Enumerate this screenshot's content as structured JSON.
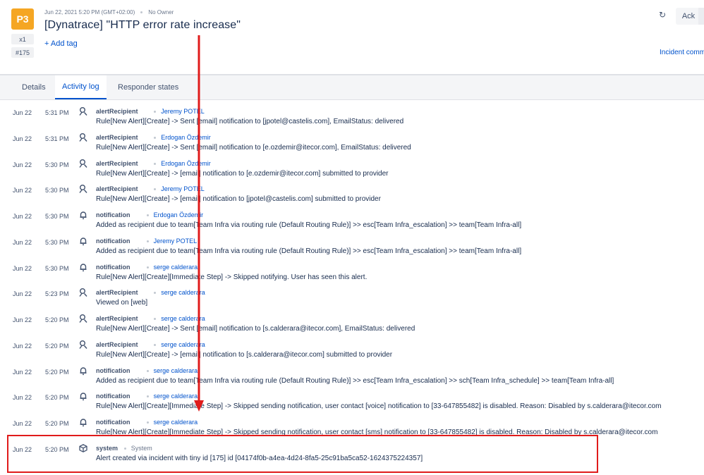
{
  "alert": {
    "priority": "P3",
    "count": "x1",
    "tiny_id": "#175",
    "created": "Jun 22, 2021 5:20 PM (GMT+02:00)",
    "owner": "No Owner",
    "title": "[Dynatrace] \"HTTP error rate increase\"",
    "add_tag": "+ Add tag",
    "incident_link": "Incident commander"
  },
  "actions": {
    "ack_label": "Ack"
  },
  "colors": {
    "priority": "#f5a623",
    "link": "#0052cc",
    "annotation": "#e01b1b"
  },
  "tabs": [
    {
      "label": "Details",
      "active": false
    },
    {
      "label": "Activity log",
      "active": true
    },
    {
      "label": "Responder states",
      "active": false
    }
  ],
  "activity": [
    {
      "date": "Jun 22",
      "time": "5:31 PM",
      "icon": "user-bell-icon",
      "type": "alertRecipient",
      "actor": "Jeremy POTEL",
      "message": "Rule[New Alert][Create] -> Sent [email] notification to [jpotel@castelis.com], EmailStatus: delivered"
    },
    {
      "date": "Jun 22",
      "time": "5:31 PM",
      "icon": "user-bell-icon",
      "type": "alertRecipient",
      "actor": "Erdogan Özdemir",
      "message": "Rule[New Alert][Create] -> Sent [email] notification to [e.ozdemir@itecor.com], EmailStatus: delivered"
    },
    {
      "date": "Jun 22",
      "time": "5:30 PM",
      "icon": "user-bell-icon",
      "type": "alertRecipient",
      "actor": "Erdogan Özdemir",
      "message": "Rule[New Alert][Create] -> [email] notification to [e.ozdemir@itecor.com] submitted to provider"
    },
    {
      "date": "Jun 22",
      "time": "5:30 PM",
      "icon": "user-bell-icon",
      "type": "alertRecipient",
      "actor": "Jeremy POTEL",
      "message": "Rule[New Alert][Create] -> [email] notification to [jpotel@castelis.com] submitted to provider"
    },
    {
      "date": "Jun 22",
      "time": "5:30 PM",
      "icon": "bell-icon",
      "type": "notification",
      "actor": "Erdogan Özdemir",
      "message": "Added as recipient due to team[Team Infra via routing rule (Default Routing Rule)] >> esc[Team Infra_escalation] >> team[Team Infra-all]"
    },
    {
      "date": "Jun 22",
      "time": "5:30 PM",
      "icon": "bell-icon",
      "type": "notification",
      "actor": "Jeremy POTEL",
      "message": "Added as recipient due to team[Team Infra via routing rule (Default Routing Rule)] >> esc[Team Infra_escalation] >> team[Team Infra-all]"
    },
    {
      "date": "Jun 22",
      "time": "5:30 PM",
      "icon": "bell-icon",
      "type": "notification",
      "actor": "serge calderara",
      "message": "Rule[New Alert][Create][Immediate Step] -> Skipped notifying. User has seen this alert."
    },
    {
      "date": "Jun 22",
      "time": "5:23 PM",
      "icon": "user-bell-icon",
      "type": "alertRecipient",
      "actor": "serge calderara",
      "message": "Viewed on [web]"
    },
    {
      "date": "Jun 22",
      "time": "5:20 PM",
      "icon": "user-bell-icon",
      "type": "alertRecipient",
      "actor": "serge calderara",
      "message": "Rule[New Alert][Create] -> Sent [email] notification to [s.calderara@itecor.com], EmailStatus: delivered"
    },
    {
      "date": "Jun 22",
      "time": "5:20 PM",
      "icon": "user-bell-icon",
      "type": "alertRecipient",
      "actor": "serge calderara",
      "message": "Rule[New Alert][Create] -> [email] notification to [s.calderara@itecor.com] submitted to provider"
    },
    {
      "date": "Jun 22",
      "time": "5:20 PM",
      "icon": "bell-icon",
      "type": "notification",
      "actor": "serge calderara",
      "message": "Added as recipient due to team[Team Infra via routing rule (Default Routing Rule)] >> esc[Team Infra_escalation] >> sch[Team Infra_schedule] >> team[Team Infra-all]"
    },
    {
      "date": "Jun 22",
      "time": "5:20 PM",
      "icon": "bell-icon",
      "type": "notification",
      "actor": "serge calderara",
      "message": "Rule[New Alert][Create][Immediate Step] -> Skipped sending notification, user contact [voice] notification to [33-647855482] is disabled. Reason: Disabled by s.calderara@itecor.com"
    },
    {
      "date": "Jun 22",
      "time": "5:20 PM",
      "icon": "bell-icon",
      "type": "notification",
      "actor": "serge calderara",
      "message": "Rule[New Alert][Create][Immediate Step] -> Skipped sending notification, user contact [sms] notification to [33-647855482] is disabled. Reason: Disabled by s.calderara@itecor.com"
    },
    {
      "date": "Jun 22",
      "time": "5:20 PM",
      "icon": "cube-icon",
      "type": "system",
      "actor": "System",
      "message": "Alert created via incident with tiny id [175] id [04174f0b-a4ea-4d24-8fa5-25c91ba5ca52-1624375224357]"
    }
  ]
}
